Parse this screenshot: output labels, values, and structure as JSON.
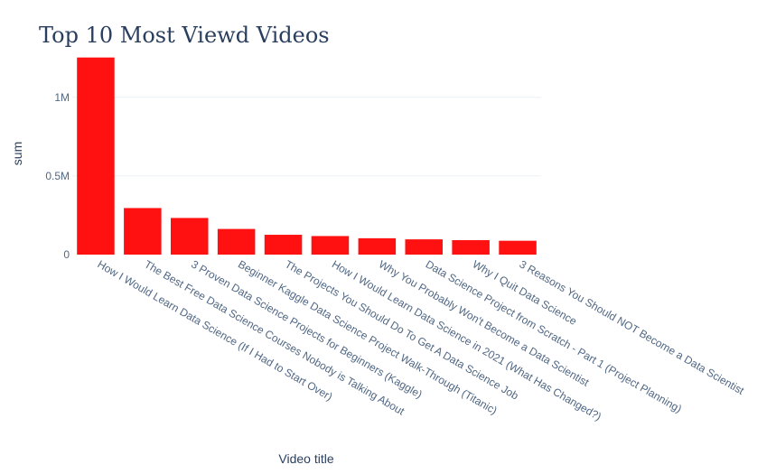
{
  "chart_data": {
    "type": "bar",
    "title": "Top 10 Most Viewd Videos",
    "xlabel": "Video title",
    "ylabel": "sum",
    "categories": [
      "How I Would Learn Data Science (If I Had to Start Over)",
      "The Best Free Data Science Courses Nobody is Talking About",
      "3 Proven Data Science Projects for Beginners (Kaggle)",
      "Beginner Kaggle Data Science Project Walk-Through (Titanic)",
      "The Projects You Should Do To Get A Data Science Job",
      "How I Would Learn Data Science in 2021 (What Has Changed?)",
      "Why You Probably Won't Become a Data Scientist",
      "Data Science Project from Scratch - Part 1 (Project Planning)",
      "Why I Quit Data Science",
      "3 Reasons You Should NOT Become a Data Scientist"
    ],
    "values": [
      1253000,
      296000,
      233000,
      163000,
      126000,
      118000,
      104000,
      97000,
      92000,
      88000
    ],
    "ylim": [
      0,
      1320000
    ],
    "yticks": [
      {
        "value": 0,
        "label": "0"
      },
      {
        "value": 500000,
        "label": "0.5M"
      },
      {
        "value": 1000000,
        "label": "1M"
      }
    ],
    "bar_color": "#ff1111",
    "grid": true,
    "grid_color": "#ebf0f8"
  }
}
